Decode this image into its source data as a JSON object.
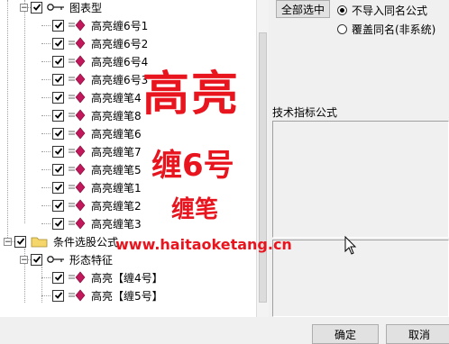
{
  "tree": {
    "nodes": [
      {
        "label": "图表型",
        "level": 1,
        "expander": "minus",
        "checked": true,
        "icon": "key-icon"
      },
      {
        "label": "高亮缠6号1",
        "level": 2,
        "checked": true,
        "icon": "formula-diamond-icon"
      },
      {
        "label": "高亮缠6号2",
        "level": 2,
        "checked": true,
        "icon": "formula-diamond-icon"
      },
      {
        "label": "高亮缠6号4",
        "level": 2,
        "checked": true,
        "icon": "formula-diamond-icon"
      },
      {
        "label": "高亮缠6号3",
        "level": 2,
        "checked": true,
        "icon": "formula-diamond-icon"
      },
      {
        "label": "高亮缠笔4",
        "level": 2,
        "checked": true,
        "icon": "formula-diamond-icon"
      },
      {
        "label": "高亮缠笔8",
        "level": 2,
        "checked": true,
        "icon": "formula-diamond-icon"
      },
      {
        "label": "高亮缠笔6",
        "level": 2,
        "checked": true,
        "icon": "formula-diamond-icon"
      },
      {
        "label": "高亮缠笔7",
        "level": 2,
        "checked": true,
        "icon": "formula-diamond-icon"
      },
      {
        "label": "高亮缠笔5",
        "level": 2,
        "checked": true,
        "icon": "formula-diamond-icon"
      },
      {
        "label": "高亮缠笔1",
        "level": 2,
        "checked": true,
        "icon": "formula-diamond-icon"
      },
      {
        "label": "高亮缠笔2",
        "level": 2,
        "checked": true,
        "icon": "formula-diamond-icon"
      },
      {
        "label": "高亮缠笔3",
        "level": 2,
        "checked": true,
        "icon": "formula-diamond-icon"
      },
      {
        "label": "条件选股公式",
        "level": 0,
        "expander": "minus",
        "checked": true,
        "icon": "folder-icon"
      },
      {
        "label": "形态特征",
        "level": 1,
        "expander": "minus",
        "checked": true,
        "icon": "key-icon"
      },
      {
        "label": "高亮【缠4号】",
        "level": 2,
        "checked": true,
        "icon": "formula-diamond-icon"
      },
      {
        "label": "高亮【缠5号】",
        "level": 2,
        "checked": true,
        "icon": "formula-diamond-icon"
      }
    ]
  },
  "right": {
    "select_all_label": "全部选中",
    "radio_options": [
      {
        "label": "不导入同名公式",
        "selected": true
      },
      {
        "label": "覆盖同名(非系统)",
        "selected": false
      }
    ],
    "info_label": "技术指标公式"
  },
  "buttons": {
    "ok": "确定",
    "cancel": "取消"
  },
  "watermark": {
    "title": "高亮",
    "subtitle": "缠6号",
    "subtitle2": "缠笔",
    "url": "www.haitaoketang.cn"
  },
  "colors": {
    "watermark": "#e8141e",
    "diamond": "#c2185b",
    "folder": "#f5d66b"
  }
}
